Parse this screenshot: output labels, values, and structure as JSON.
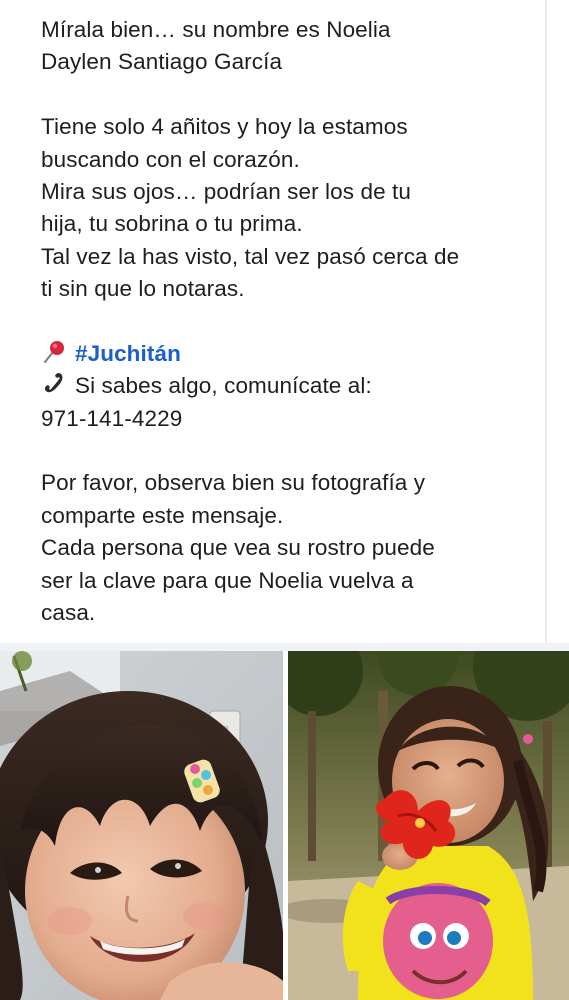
{
  "post": {
    "lines_intro": [
      "Mírala bien… su nombre es Noelia",
      "Daylen Santiago García"
    ],
    "lines_body": [
      "Tiene solo 4 añitos y hoy la estamos",
      "buscando con el corazón.",
      "Mira sus ojos… podrían ser los de tu",
      "hija, tu sobrina o tu prima.",
      "Tal vez la has visto, tal vez pasó cerca de",
      "ti sin que lo notaras."
    ],
    "hashtag": "#Juchitán",
    "contact_line": "Si sabes algo, comunícate al:",
    "phone": "971-141-4229",
    "lines_closing": [
      "Por favor, observa bien su fotografía y",
      "comparte este mensaje.",
      "Cada persona que vea su rostro puede",
      "ser la clave para que Noelia vuelva a",
      "casa."
    ]
  },
  "icons": {
    "pin": "round-pushpin-icon",
    "phone": "telephone-receiver-icon"
  },
  "colors": {
    "text": "#1c1e21",
    "hashtag": "#1b5fc9",
    "pin_red": "#d7263d",
    "background": "#ffffff"
  }
}
